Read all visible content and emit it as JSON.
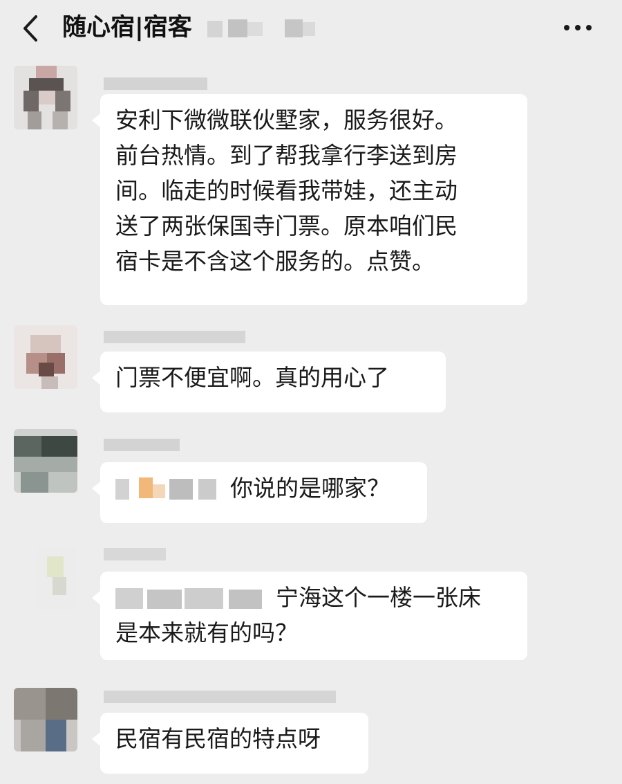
{
  "header": {
    "title": "随心宿|宿客",
    "back_icon": "chevron-left-icon",
    "more_icon": "more-dots-icon"
  },
  "messages": [
    {
      "lines": [
        "安利下微微联伙墅家，服务很好。",
        "前台热情。到了帮我拿行李送到房",
        "间。临走的时候看我带娃，还主动",
        "送了两张保国寺门票。原本咱们民",
        "宿卡是不含这个服务的。点赞。"
      ]
    },
    {
      "lines": [
        "门票不便宜啊。真的用心了"
      ]
    },
    {
      "lines": [
        "你说的是哪家？"
      ]
    },
    {
      "lines": [
        "宁海这个一楼一张床",
        "是本来就有的吗？"
      ]
    },
    {
      "lines": [
        "民宿有民宿的特点呀"
      ]
    }
  ]
}
